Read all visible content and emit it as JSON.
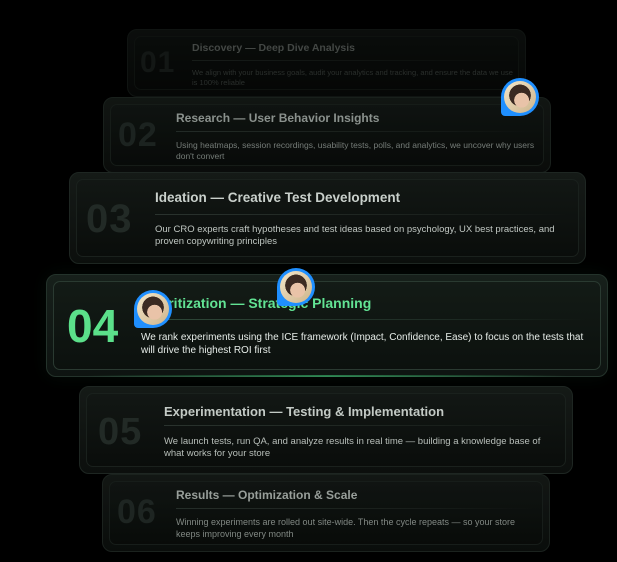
{
  "steps": [
    {
      "number": "01",
      "title": "Discovery — Deep Dive Analysis",
      "description": "We align with your business goals, audit your analytics and tracking, and ensure the data we use is 100% reliable"
    },
    {
      "number": "02",
      "title": "Research — User Behavior Insights",
      "description": "Using heatmaps, session recordings, usability tests, polls, and analytics, we uncover why users don't convert"
    },
    {
      "number": "03",
      "title": "Ideation — Creative Test Development",
      "description": "Our CRO experts craft hypotheses and test ideas based on psychology, UX best practices, and proven copywriting principles"
    },
    {
      "number": "04",
      "title": "Prioritization — Strategic Planning",
      "description": "We rank experiments using the ICE framework (Impact, Confidence, Ease) to focus on the tests that will drive the highest ROI first"
    },
    {
      "number": "05",
      "title": "Experimentation — Testing & Implementation",
      "description": "We launch tests, run QA, and analyze results in real time — building a knowledge base of what works for your store"
    },
    {
      "number": "06",
      "title": "Results — Optimization & Scale",
      "description": "Winning experiments are rolled out site-wide. Then the cycle repeats — so your store keeps improving every month"
    }
  ],
  "active_step": "04",
  "colors": {
    "accent": "#5be08a",
    "background": "#000000",
    "avatar_ring": "#1f8fff"
  },
  "avatars": [
    "avatar-photo",
    "avatar-photo",
    "avatar-photo"
  ]
}
